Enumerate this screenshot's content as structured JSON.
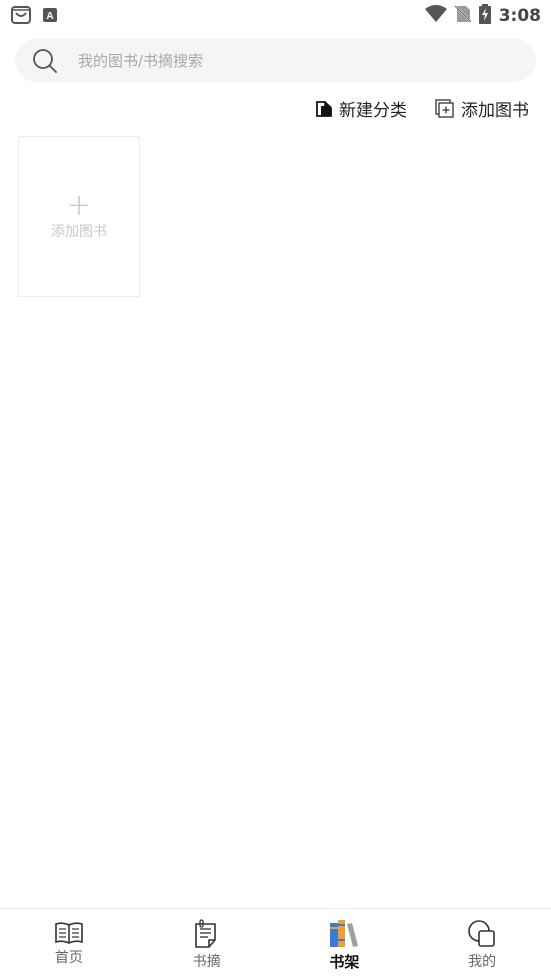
{
  "status_bar": {
    "time": "3:08",
    "left_icons": [
      "shopping-bag-icon",
      "keyboard-a-icon"
    ],
    "right_icons": [
      "wifi-icon",
      "no-sim-icon",
      "battery-charging-icon"
    ]
  },
  "search": {
    "placeholder": "我的图书/书摘搜索"
  },
  "toolbar": {
    "new_category_label": "新建分类",
    "add_book_label": "添加图书"
  },
  "shelf": {
    "add_card_plus": "+",
    "add_card_label": "添加图书"
  },
  "tabs": [
    {
      "label": "首页",
      "icon": "book-open-icon",
      "active": false
    },
    {
      "label": "书摘",
      "icon": "notes-icon",
      "active": false
    },
    {
      "label": "书架",
      "icon": "bookshelf-icon",
      "active": true
    },
    {
      "label": "我的",
      "icon": "profile-icon",
      "active": false
    }
  ],
  "colors": {
    "search_bg": "#f5f5f5",
    "placeholder": "#a8a8a8",
    "shelf_blue": "#3a7bd5",
    "shelf_orange": "#f0a030",
    "shelf_gray": "#a0a0a0"
  }
}
